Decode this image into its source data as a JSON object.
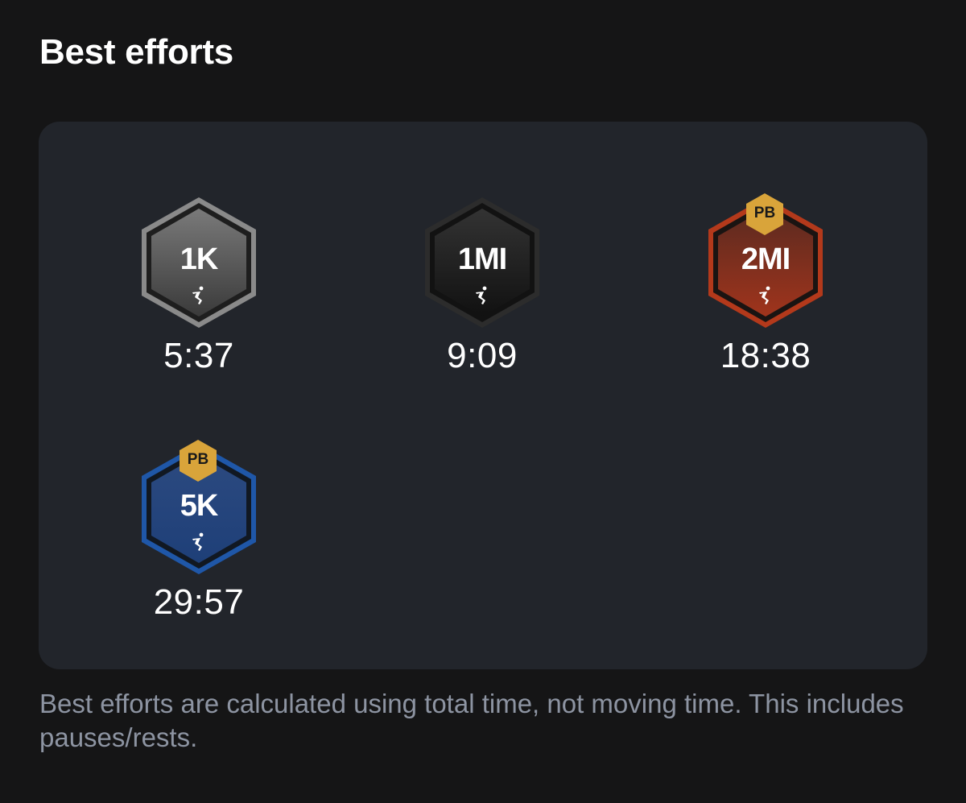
{
  "section": {
    "title": "Best efforts",
    "footnote": "Best efforts are calculated using total time, not moving time. This includes pauses/rests."
  },
  "efforts": [
    {
      "label": "1K",
      "time": "5:37",
      "pb": false,
      "pb_label": "",
      "badge_style": "gray",
      "icon": "runner-icon"
    },
    {
      "label": "1MI",
      "time": "9:09",
      "pb": false,
      "pb_label": "",
      "badge_style": "black",
      "icon": "runner-icon"
    },
    {
      "label": "2MI",
      "time": "18:38",
      "pb": true,
      "pb_label": "PB",
      "badge_style": "red",
      "icon": "runner-icon"
    },
    {
      "label": "5K",
      "time": "29:57",
      "pb": true,
      "pb_label": "PB",
      "badge_style": "blue",
      "icon": "runner-icon"
    }
  ],
  "colors": {
    "background": "#151516",
    "card": "#22252b",
    "footnote": "#8d94a2",
    "pb_gold": "#d9a43a",
    "gray_rim": "#8a8a8a",
    "black_rim": "#2a2a2a",
    "red_rim": "#b3391b",
    "blue_rim": "#1f57a8"
  }
}
